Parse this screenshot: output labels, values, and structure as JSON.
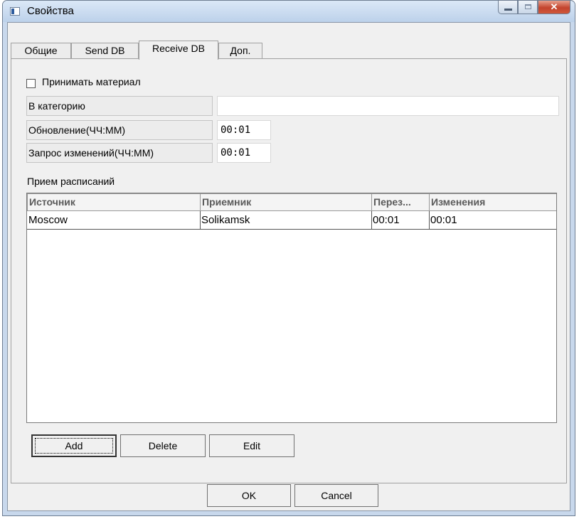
{
  "window": {
    "title": "Свойства",
    "close_glyph": "✕",
    "icon": "properties-window-icon"
  },
  "tabs": [
    {
      "label": "Общие",
      "active": false
    },
    {
      "label": "Send DB",
      "active": false
    },
    {
      "label": "Receive DB",
      "active": true
    },
    {
      "label": "Доп.",
      "active": false
    }
  ],
  "receive": {
    "checkbox_label": "Принимать материал",
    "checked": false,
    "category_label": "В категорию",
    "category_value": "",
    "update_label": "Обновление(ЧЧ:ММ)",
    "update_value": "00:01",
    "changes_label": "Запрос изменений(ЧЧ:ММ)",
    "changes_value": "00:01"
  },
  "schedules": {
    "label": "Прием расписаний",
    "columns": [
      "Источник",
      "Приемник",
      "Перез...",
      "Изменения"
    ],
    "rows": [
      [
        "Moscow",
        "Solikamsk",
        "00:01",
        "00:01"
      ]
    ]
  },
  "buttons": {
    "add": "Add",
    "delete": "Delete",
    "edit": "Edit",
    "ok": "OK",
    "cancel": "Cancel"
  }
}
